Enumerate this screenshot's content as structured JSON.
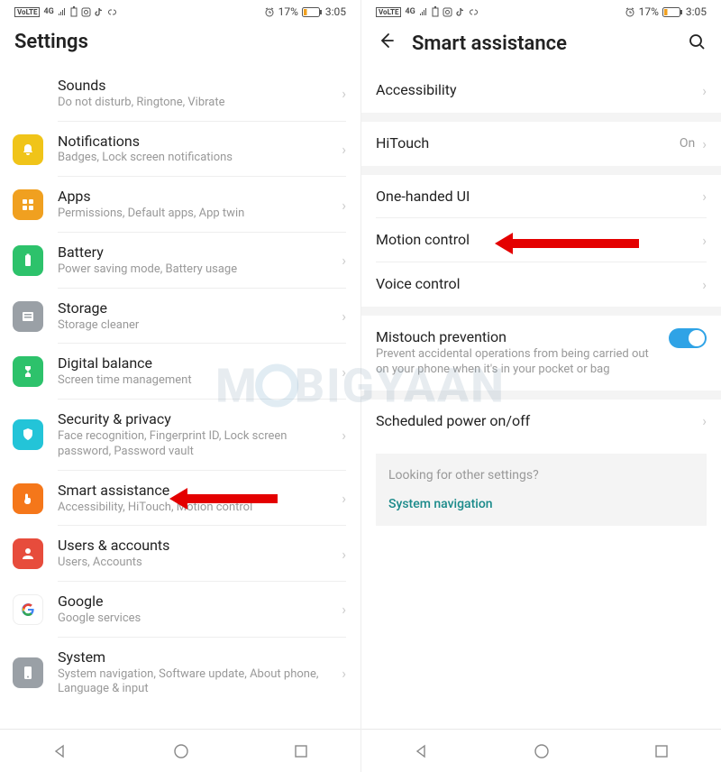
{
  "status": {
    "volte": "VoLTE",
    "signal": "4G",
    "battery_pct": "17%",
    "time": "3:05",
    "alarm": "⏰"
  },
  "left": {
    "title": "Settings",
    "items": [
      {
        "key": "sounds",
        "title": "Sounds",
        "sub": "Do not disturb, Ringtone, Vibrate",
        "icon_bg": "#8a5cf5"
      },
      {
        "key": "notifications",
        "title": "Notifications",
        "sub": "Badges, Lock screen notifications",
        "icon_bg": "#f0c419"
      },
      {
        "key": "apps",
        "title": "Apps",
        "sub": "Permissions, Default apps, App twin",
        "icon_bg": "#f0a020"
      },
      {
        "key": "battery",
        "title": "Battery",
        "sub": "Power saving mode, Battery usage",
        "icon_bg": "#2dc26b"
      },
      {
        "key": "storage",
        "title": "Storage",
        "sub": "Storage cleaner",
        "icon_bg": "#9aa0a6"
      },
      {
        "key": "digital-balance",
        "title": "Digital balance",
        "sub": "Screen time management",
        "icon_bg": "#2dc26b"
      },
      {
        "key": "security",
        "title": "Security & privacy",
        "sub": "Face recognition, Fingerprint ID, Lock screen password, Password vault",
        "icon_bg": "#23c4d8"
      },
      {
        "key": "smart-assistance",
        "title": "Smart assistance",
        "sub": "Accessibility, HiTouch, Motion control",
        "icon_bg": "#f5771a"
      },
      {
        "key": "users",
        "title": "Users & accounts",
        "sub": "Users, Accounts",
        "icon_bg": "#e74c3c"
      },
      {
        "key": "google",
        "title": "Google",
        "sub": "Google services",
        "icon_bg": "#ffffff"
      },
      {
        "key": "system",
        "title": "System",
        "sub": "System navigation, Software update, About phone, Language & input",
        "icon_bg": "#9aa0a6"
      }
    ]
  },
  "right": {
    "title": "Smart assistance",
    "groups": [
      [
        {
          "key": "accessibility",
          "title": "Accessibility",
          "chevron": true
        }
      ],
      [
        {
          "key": "hitouch",
          "title": "HiTouch",
          "value": "On",
          "chevron": true
        }
      ],
      [
        {
          "key": "one-handed",
          "title": "One-handed UI",
          "chevron": true
        },
        {
          "key": "motion-control",
          "title": "Motion control",
          "chevron": true
        },
        {
          "key": "voice-control",
          "title": "Voice control",
          "chevron": true
        }
      ],
      [
        {
          "key": "mistouch",
          "title": "Mistouch prevention",
          "sub": "Prevent accidental operations from being carried out on your phone when it's in your pocket or bag",
          "toggle": true
        }
      ],
      [
        {
          "key": "scheduled-power",
          "title": "Scheduled power on/off",
          "chevron": true
        }
      ]
    ],
    "hint": {
      "title": "Looking for other settings?",
      "link": "System navigation"
    }
  },
  "watermark": "MOBIGYAAN"
}
